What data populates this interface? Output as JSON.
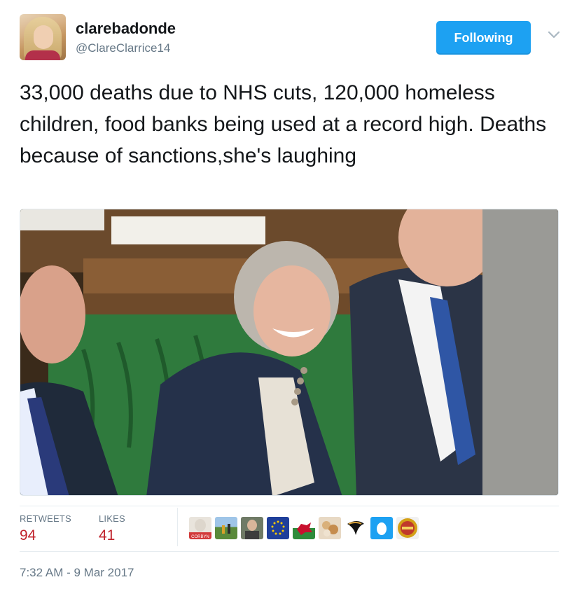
{
  "user": {
    "display_name": "clarebadonde",
    "handle": "@ClareClarrice14"
  },
  "follow_button": {
    "label": "Following"
  },
  "tweet": {
    "text": "33,000 deaths due to NHS cuts, 120,000 homeless children, food banks being used at a record high. Deaths because of sanctions,she's laughing"
  },
  "stats": {
    "retweets_label": "RETWEETS",
    "retweets_count": "94",
    "likes_label": "LIKES",
    "likes_count": "41"
  },
  "liker_avatars": [
    {
      "icon": "liker-avatar-corbyn",
      "caption": "CORBYN"
    },
    {
      "icon": "liker-avatar-field"
    },
    {
      "icon": "liker-avatar-man"
    },
    {
      "icon": "liker-avatar-eu-flag"
    },
    {
      "icon": "liker-avatar-welsh-flag"
    },
    {
      "icon": "liker-avatar-food"
    },
    {
      "icon": "liker-avatar-swoosh"
    },
    {
      "icon": "liker-avatar-egg"
    },
    {
      "icon": "liker-avatar-badge"
    }
  ],
  "timestamp": "7:32 AM - 9 Mar 2017",
  "colors": {
    "accent": "#1da1f2",
    "count": "#c0232c",
    "muted": "#657786"
  }
}
